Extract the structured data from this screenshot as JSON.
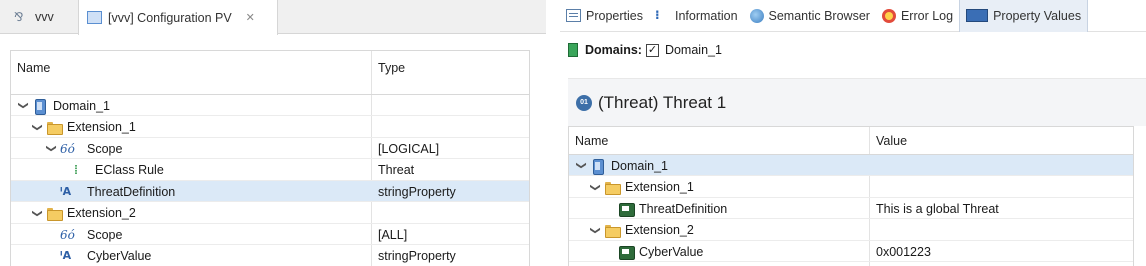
{
  "left": {
    "tabs": {
      "inactive_label": "vvv",
      "active_label": "[vvv] Configuration PV",
      "close_glyph": "✕"
    },
    "table": {
      "headers": {
        "name": "Name",
        "type": "Type"
      },
      "rows": [
        {
          "name": "Domain_1",
          "type": "",
          "twisty": "⌄",
          "icon": "domain-icon"
        },
        {
          "name": "Extension_1",
          "type": "",
          "twisty": "⌄",
          "icon": "folder-icon"
        },
        {
          "name": "Scope",
          "type": "[LOGICAL]",
          "twisty": "⌄",
          "icon": "scope-icon",
          "icon_text": "6ó"
        },
        {
          "name": "EClass Rule",
          "type": "Threat",
          "twisty": "",
          "icon": "rule-icon",
          "icon_text": "⁞"
        },
        {
          "name": "ThreatDefinition",
          "type": "stringProperty",
          "twisty": "",
          "icon": "attribute-icon",
          "icon_text": "ᴵA",
          "selected": true
        },
        {
          "name": "Extension_2",
          "type": "",
          "twisty": "⌄",
          "icon": "folder-icon"
        },
        {
          "name": "Scope",
          "type": "[ALL]",
          "twisty": "",
          "icon": "scope-icon",
          "icon_text": "6ó"
        },
        {
          "name": "CyberValue",
          "type": "stringProperty",
          "twisty": "",
          "icon": "attribute-icon",
          "icon_text": "ᴵA"
        }
      ]
    }
  },
  "right": {
    "view_tabs": [
      {
        "label": "Properties",
        "icon": "properties-icon"
      },
      {
        "label": "Information",
        "icon": "information-icon"
      },
      {
        "label": "Semantic Browser",
        "icon": "semantic-browser-icon"
      },
      {
        "label": "Error Log",
        "icon": "error-log-icon"
      },
      {
        "label": "Property Values",
        "icon": "property-values-icon",
        "active": true
      }
    ],
    "domains": {
      "label": "Domains:",
      "checkbox": "✓",
      "value": "Domain_1"
    },
    "section": {
      "icon_text": "01",
      "title": "(Threat) Threat 1"
    },
    "table": {
      "headers": {
        "name": "Name",
        "value": "Value"
      },
      "rows": [
        {
          "name": "Domain_1",
          "value": "",
          "twisty": "⌄",
          "icon": "domain-icon",
          "selected": true
        },
        {
          "name": "Extension_1",
          "value": "",
          "twisty": "⌄",
          "icon": "folder-icon"
        },
        {
          "name": "ThreatDefinition",
          "value": "This is a global Threat",
          "twisty": "",
          "icon": "value-icon"
        },
        {
          "name": "Extension_2",
          "value": "",
          "twisty": "⌄",
          "icon": "folder-icon"
        },
        {
          "name": "CyberValue",
          "value": "0x001223",
          "twisty": "",
          "icon": "value-icon"
        }
      ]
    }
  },
  "colors": {
    "selection": "#dbe9f7",
    "accent": "#2d5fa6"
  }
}
